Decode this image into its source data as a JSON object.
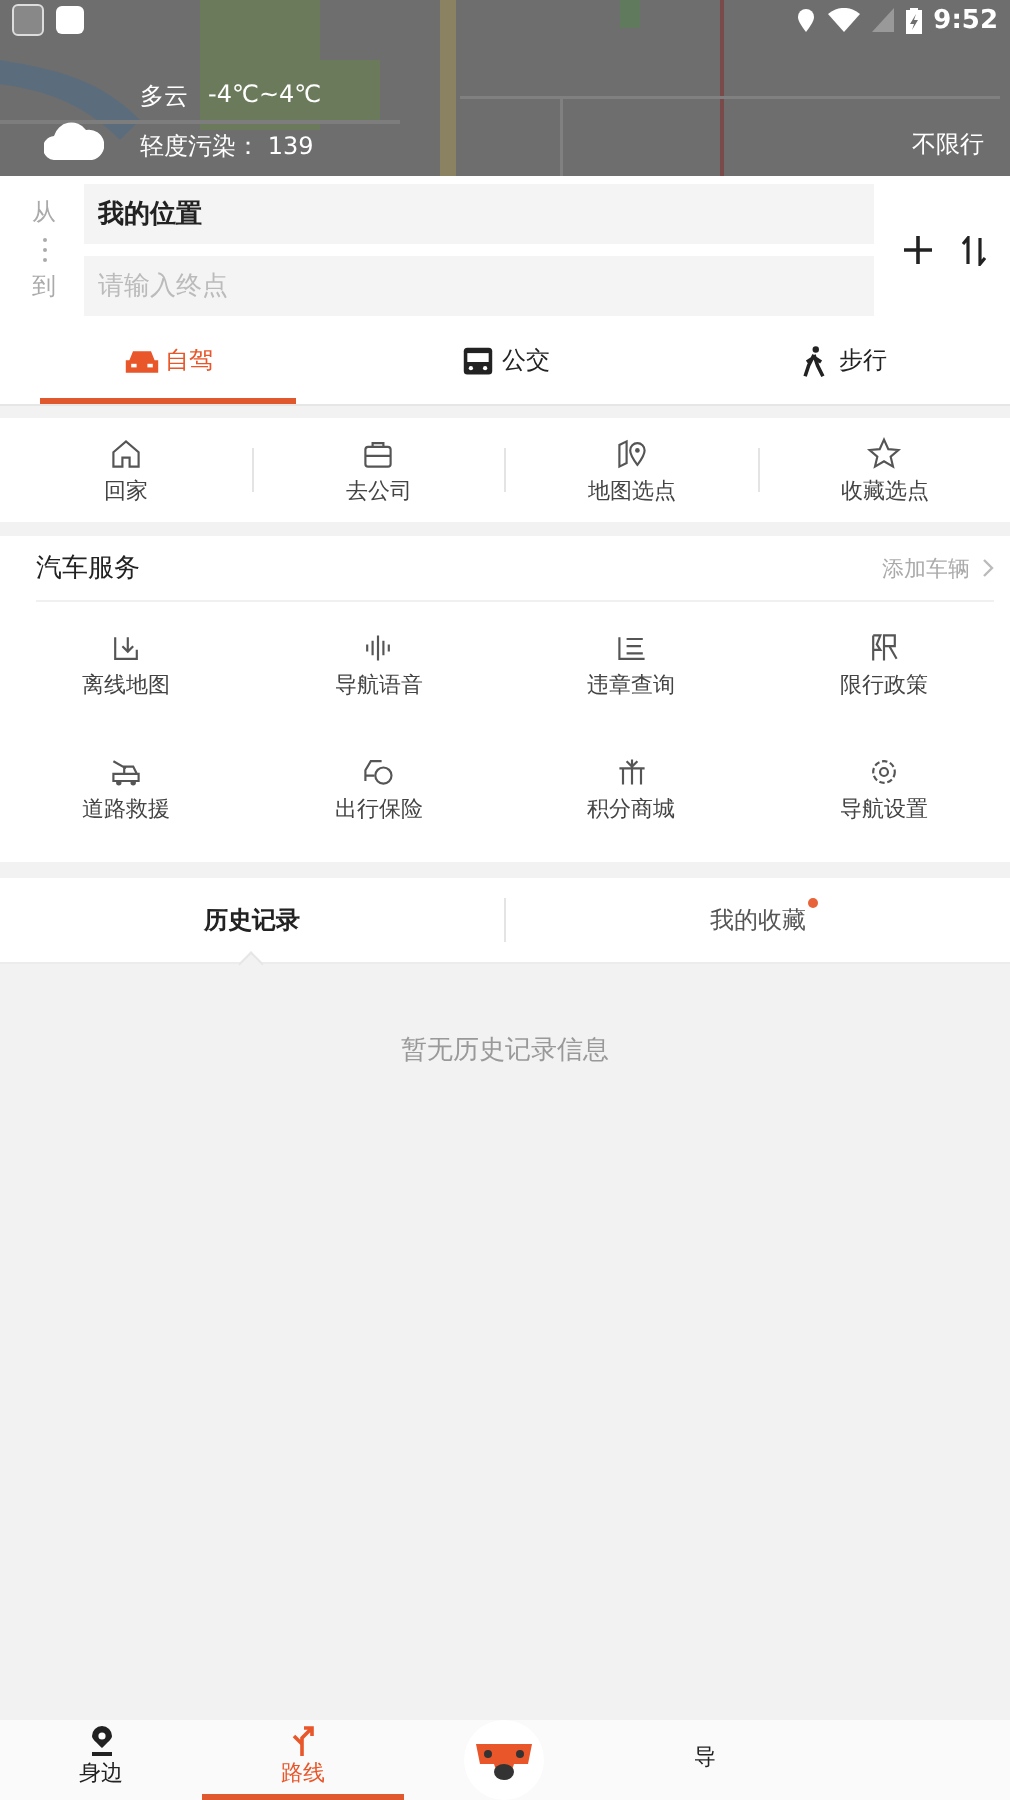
{
  "status_bar": {
    "time": "9:52"
  },
  "map": {
    "weather": {
      "condition": "多云",
      "temperature": "-4℃~4℃",
      "air_quality": "轻度污染： 139"
    },
    "restriction": "不限行"
  },
  "route": {
    "from_label": "从",
    "to_label": "到",
    "from_value": "我的位置",
    "to_placeholder": "请输入终点"
  },
  "mode_tabs": [
    {
      "label": "自驾",
      "kind": "car",
      "selected": true
    },
    {
      "label": "公交",
      "kind": "bus",
      "selected": false
    },
    {
      "label": "步行",
      "kind": "walk",
      "selected": false
    }
  ],
  "quick_places": [
    {
      "label": "回家",
      "kind": "home"
    },
    {
      "label": "去公司",
      "kind": "briefcase"
    },
    {
      "label": "地图选点",
      "kind": "map-pin"
    },
    {
      "label": "收藏选点",
      "kind": "star"
    }
  ],
  "car_services": {
    "title": "汽车服务",
    "action": "添加车辆",
    "items": [
      {
        "label": "离线地图",
        "kind": "download"
      },
      {
        "label": "导航语音",
        "kind": "wave"
      },
      {
        "label": "违章查询",
        "kind": "list"
      },
      {
        "label": "限行政策",
        "kind": "limit"
      },
      {
        "label": "道路救援",
        "kind": "tow"
      },
      {
        "label": "出行保险",
        "kind": "shield"
      },
      {
        "label": "积分商城",
        "kind": "gift"
      },
      {
        "label": "导航设置",
        "kind": "gear"
      }
    ]
  },
  "record_tabs": [
    {
      "label": "历史记录",
      "selected": true,
      "badge": false
    },
    {
      "label": "我的收藏",
      "selected": false,
      "badge": true
    }
  ],
  "empty_message": "暂无历史记录信息",
  "bottom_nav": [
    {
      "label": "身边",
      "kind": "pin",
      "selected": false
    },
    {
      "label": "路线",
      "kind": "route",
      "selected": true
    },
    {
      "label": "导",
      "kind": "plain",
      "selected": false
    }
  ]
}
